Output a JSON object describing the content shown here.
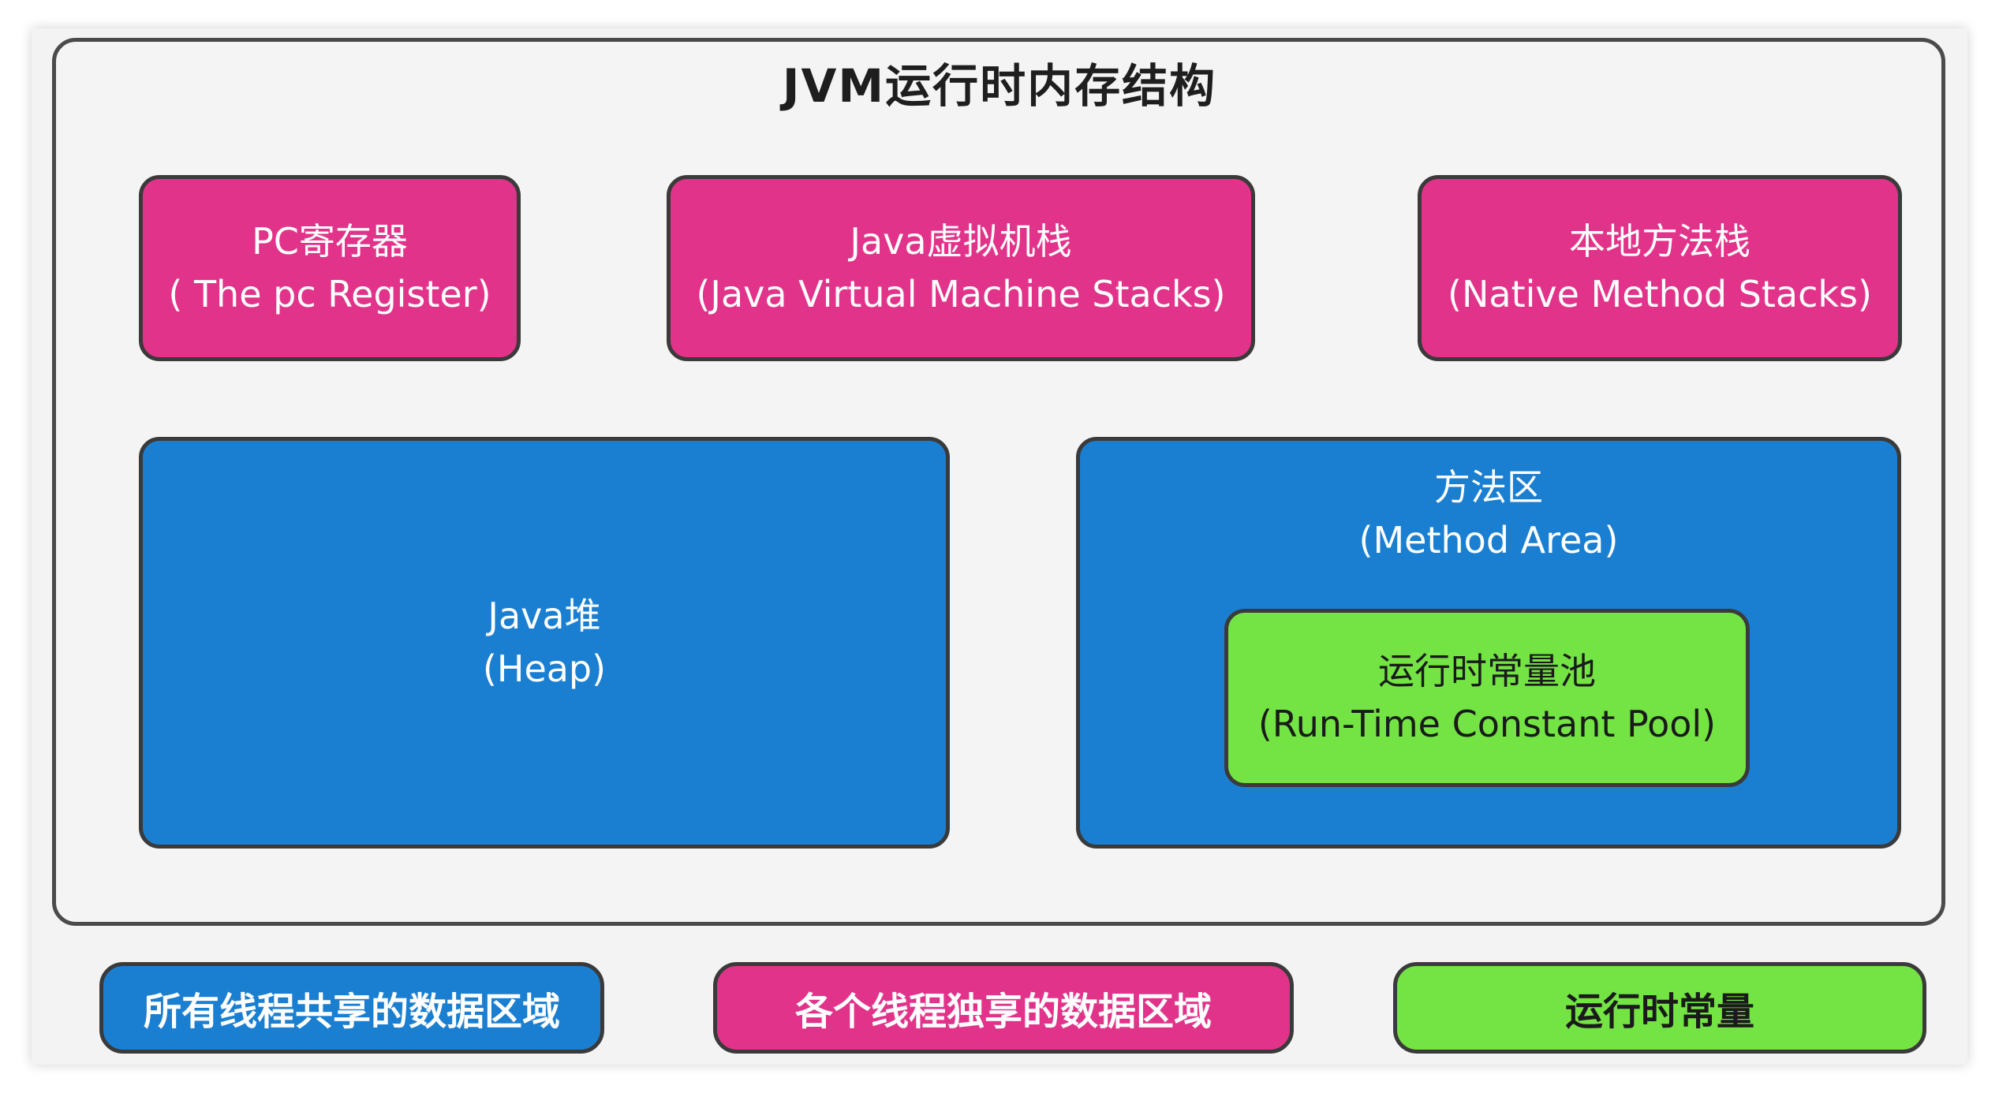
{
  "title": "JVM运行时内存结构",
  "colors": {
    "pink": "#e2338a",
    "blue": "#1b7fd1",
    "green": "#73e443",
    "outline": "#3a3a3a",
    "background": "#f4f4f4"
  },
  "areas": {
    "pc_register": {
      "zh": "PC寄存器",
      "en": "( The pc Register)"
    },
    "java_vm_stacks": {
      "zh": "Java虚拟机栈",
      "en": "(Java Virtual Machine Stacks)"
    },
    "native_method_stacks": {
      "zh": "本地方法栈",
      "en": "(Native Method Stacks)"
    },
    "heap": {
      "zh": "Java堆",
      "en": "(Heap)"
    },
    "method_area": {
      "zh": "方法区",
      "en": "(Method Area)"
    },
    "runtime_constant_pool": {
      "zh": "运行时常量池",
      "en": "(Run-Time Constant Pool)"
    }
  },
  "legend": {
    "shared": "所有线程共享的数据区域",
    "per_thread": "各个线程独享的数据区域",
    "constant": "运行时常量"
  }
}
